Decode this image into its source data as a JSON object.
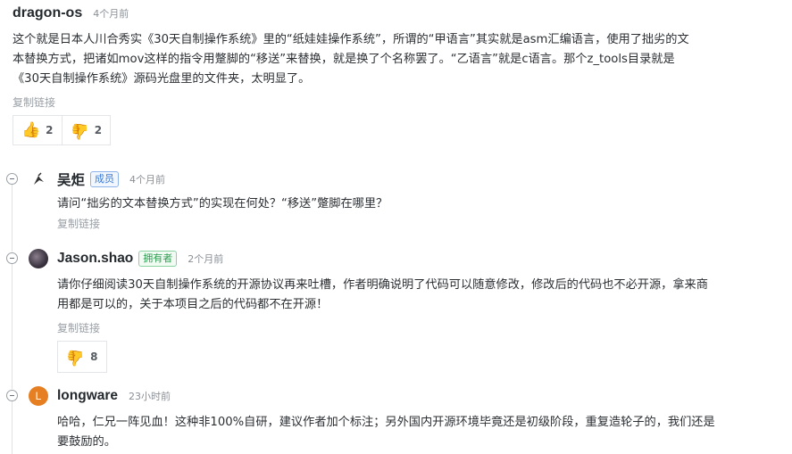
{
  "root": {
    "author": "dragon-os",
    "time": "4个月前",
    "body_lines": [
      "这个就是日本人川合秀实《30天自制操作系统》里的“纸娃娃操作系统”，所谓的“甲语言”其实就是asm汇编语言，使用了拙劣的文",
      "本替换方式，把诸如mov这样的指令用蹩脚的“移送”来替换，就是换了个名称罢了。“乙语言”就是c语言。那个z_tools目录就是",
      "《30天自制操作系统》源码光盘里的文件夹，太明显了。"
    ],
    "copy_link": "复制链接",
    "likes": "2",
    "dislikes": "2"
  },
  "replies": [
    {
      "author": "吴炬",
      "badge": "成员",
      "time": "4个月前",
      "body_lines": [
        "请问“拙劣的文本替换方式”的实现在何处？“移送”蹩脚在哪里？"
      ],
      "copy_link": "复制链接"
    },
    {
      "author": "Jason.shao",
      "badge": "拥有者",
      "time": "2个月前",
      "body_lines": [
        "请你仔细阅读30天自制操作系统的开源协议再来吐槽，作者明确说明了代码可以随意修改，修改后的代码也不必开源，拿来商",
        "用都是可以的，关于本项目之后的代码都不在开源！"
      ],
      "copy_link": "复制链接",
      "dislikes": "8"
    },
    {
      "author": "longware",
      "avatar_letter": "L",
      "time": "23小时前",
      "body_lines": [
        "哈哈，仁兄一阵见血！这种非100%自研，建议作者加个标注；另外国内开源环境毕竟还是初级阶段，重复造轮子的，我们还是",
        "要鼓励的。"
      ]
    }
  ],
  "icons": {
    "thumbs_up": "thumbs-up-icon",
    "thumbs_down": "thumbs-down-icon",
    "collapse": "collapse-icon"
  },
  "colors": {
    "member_badge": "#3a7bd5",
    "owner_badge": "#2e9e4f",
    "longware_avatar": "#e67e22"
  }
}
